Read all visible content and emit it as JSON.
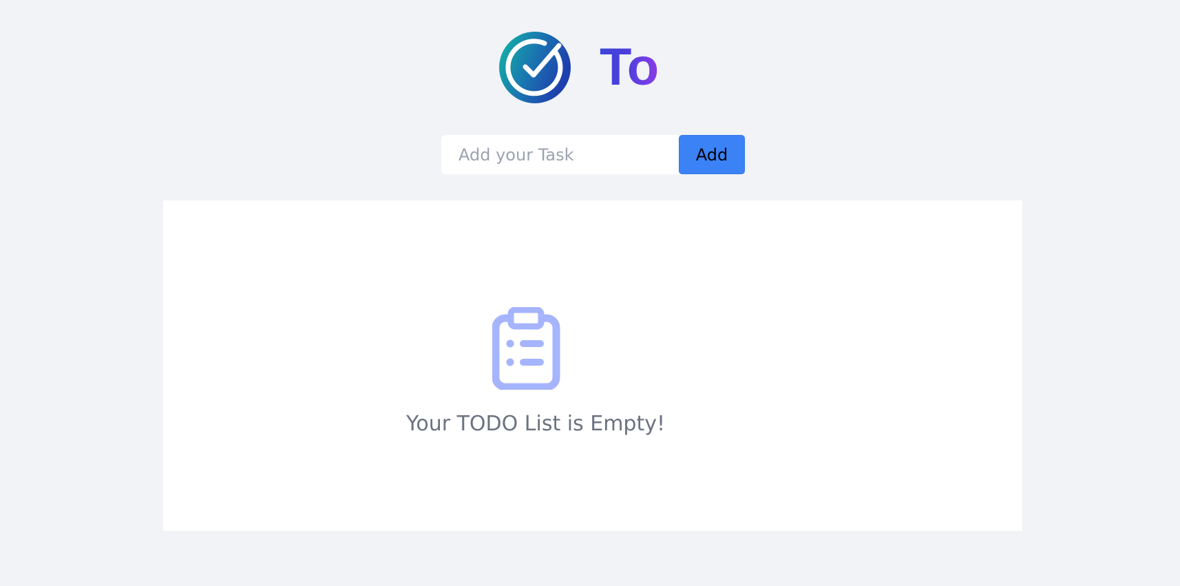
{
  "header": {
    "logo_icon": "check-circle-icon",
    "title": "To",
    "title_gradient": [
      "#3b45d6",
      "#8a3ce6"
    ],
    "logo_gradient": [
      "#14b8a6",
      "#1e40af"
    ]
  },
  "add_form": {
    "placeholder": "Add your Task",
    "value": "",
    "add_label": "Add",
    "button_color": "#3b82f6"
  },
  "todo_list": {
    "items": [],
    "empty_icon": "clipboard-list-icon",
    "empty_icon_color": "#a5b4fc",
    "empty_message": "Your TODO List is Empty!"
  },
  "colors": {
    "background": "#f1f3f6",
    "panel": "#ffffff",
    "muted_text": "#6b7280"
  }
}
